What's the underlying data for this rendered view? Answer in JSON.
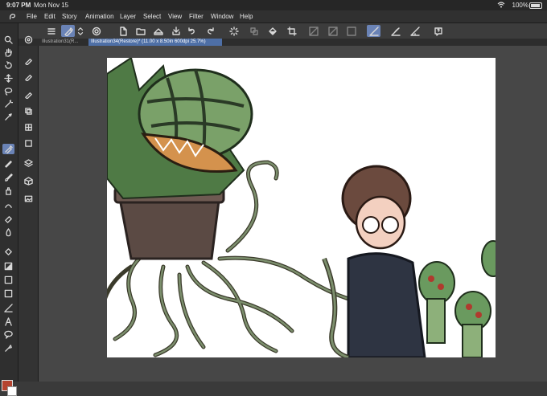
{
  "status_bar": {
    "time": "9:07 PM",
    "date": "Mon Nov 15",
    "battery": "100%"
  },
  "menu": [
    "File",
    "Edit",
    "Story",
    "Animation",
    "Layer",
    "Select",
    "View",
    "Filter",
    "Window",
    "Help"
  ],
  "tabs": [
    {
      "label": "Illustration31(R...",
      "active": false
    },
    {
      "label": "Illustration34(Restore)* (11.00 x 8.50in 600dpi 25.7%)",
      "active": true
    }
  ],
  "toolbar_icons": [
    "menu-icon",
    "brush-settings-icon",
    "chevron-updown-icon",
    "target-icon",
    "new-file-icon",
    "open-folder-icon",
    "save-icon",
    "print-icon",
    "export-icon",
    "undo-icon",
    "redo-icon",
    "loading-icon",
    "transform-icon",
    "fill-icon",
    "crop-icon",
    "snap-off-icon",
    "snap-grid-icon",
    "snap-rule-icon",
    "ruler-pen-icon",
    "perspective-icon",
    "ruler-icon",
    "help-icon"
  ],
  "primary_color": "#b5432f",
  "secondary_color": "#ffffff",
  "accent": "#6a83b6"
}
